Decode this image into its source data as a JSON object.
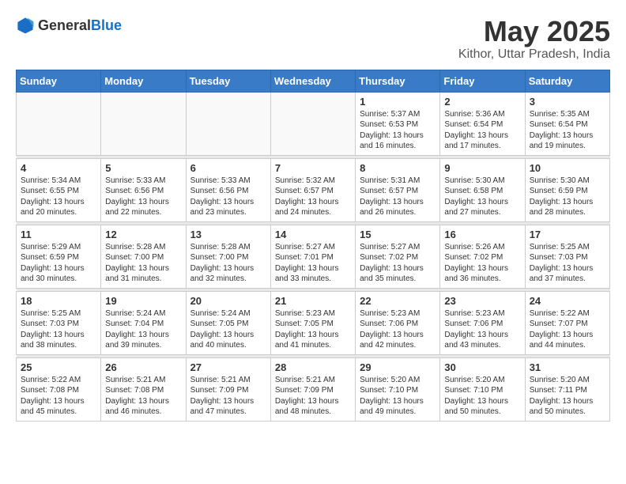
{
  "logo": {
    "general": "General",
    "blue": "Blue"
  },
  "header": {
    "month": "May 2025",
    "location": "Kithor, Uttar Pradesh, India"
  },
  "weekdays": [
    "Sunday",
    "Monday",
    "Tuesday",
    "Wednesday",
    "Thursday",
    "Friday",
    "Saturday"
  ],
  "weeks": [
    [
      {
        "day": "",
        "info": ""
      },
      {
        "day": "",
        "info": ""
      },
      {
        "day": "",
        "info": ""
      },
      {
        "day": "",
        "info": ""
      },
      {
        "day": "1",
        "info": "Sunrise: 5:37 AM\nSunset: 6:53 PM\nDaylight: 13 hours\nand 16 minutes."
      },
      {
        "day": "2",
        "info": "Sunrise: 5:36 AM\nSunset: 6:54 PM\nDaylight: 13 hours\nand 17 minutes."
      },
      {
        "day": "3",
        "info": "Sunrise: 5:35 AM\nSunset: 6:54 PM\nDaylight: 13 hours\nand 19 minutes."
      }
    ],
    [
      {
        "day": "4",
        "info": "Sunrise: 5:34 AM\nSunset: 6:55 PM\nDaylight: 13 hours\nand 20 minutes."
      },
      {
        "day": "5",
        "info": "Sunrise: 5:33 AM\nSunset: 6:56 PM\nDaylight: 13 hours\nand 22 minutes."
      },
      {
        "day": "6",
        "info": "Sunrise: 5:33 AM\nSunset: 6:56 PM\nDaylight: 13 hours\nand 23 minutes."
      },
      {
        "day": "7",
        "info": "Sunrise: 5:32 AM\nSunset: 6:57 PM\nDaylight: 13 hours\nand 24 minutes."
      },
      {
        "day": "8",
        "info": "Sunrise: 5:31 AM\nSunset: 6:57 PM\nDaylight: 13 hours\nand 26 minutes."
      },
      {
        "day": "9",
        "info": "Sunrise: 5:30 AM\nSunset: 6:58 PM\nDaylight: 13 hours\nand 27 minutes."
      },
      {
        "day": "10",
        "info": "Sunrise: 5:30 AM\nSunset: 6:59 PM\nDaylight: 13 hours\nand 28 minutes."
      }
    ],
    [
      {
        "day": "11",
        "info": "Sunrise: 5:29 AM\nSunset: 6:59 PM\nDaylight: 13 hours\nand 30 minutes."
      },
      {
        "day": "12",
        "info": "Sunrise: 5:28 AM\nSunset: 7:00 PM\nDaylight: 13 hours\nand 31 minutes."
      },
      {
        "day": "13",
        "info": "Sunrise: 5:28 AM\nSunset: 7:00 PM\nDaylight: 13 hours\nand 32 minutes."
      },
      {
        "day": "14",
        "info": "Sunrise: 5:27 AM\nSunset: 7:01 PM\nDaylight: 13 hours\nand 33 minutes."
      },
      {
        "day": "15",
        "info": "Sunrise: 5:27 AM\nSunset: 7:02 PM\nDaylight: 13 hours\nand 35 minutes."
      },
      {
        "day": "16",
        "info": "Sunrise: 5:26 AM\nSunset: 7:02 PM\nDaylight: 13 hours\nand 36 minutes."
      },
      {
        "day": "17",
        "info": "Sunrise: 5:25 AM\nSunset: 7:03 PM\nDaylight: 13 hours\nand 37 minutes."
      }
    ],
    [
      {
        "day": "18",
        "info": "Sunrise: 5:25 AM\nSunset: 7:03 PM\nDaylight: 13 hours\nand 38 minutes."
      },
      {
        "day": "19",
        "info": "Sunrise: 5:24 AM\nSunset: 7:04 PM\nDaylight: 13 hours\nand 39 minutes."
      },
      {
        "day": "20",
        "info": "Sunrise: 5:24 AM\nSunset: 7:05 PM\nDaylight: 13 hours\nand 40 minutes."
      },
      {
        "day": "21",
        "info": "Sunrise: 5:23 AM\nSunset: 7:05 PM\nDaylight: 13 hours\nand 41 minutes."
      },
      {
        "day": "22",
        "info": "Sunrise: 5:23 AM\nSunset: 7:06 PM\nDaylight: 13 hours\nand 42 minutes."
      },
      {
        "day": "23",
        "info": "Sunrise: 5:23 AM\nSunset: 7:06 PM\nDaylight: 13 hours\nand 43 minutes."
      },
      {
        "day": "24",
        "info": "Sunrise: 5:22 AM\nSunset: 7:07 PM\nDaylight: 13 hours\nand 44 minutes."
      }
    ],
    [
      {
        "day": "25",
        "info": "Sunrise: 5:22 AM\nSunset: 7:08 PM\nDaylight: 13 hours\nand 45 minutes."
      },
      {
        "day": "26",
        "info": "Sunrise: 5:21 AM\nSunset: 7:08 PM\nDaylight: 13 hours\nand 46 minutes."
      },
      {
        "day": "27",
        "info": "Sunrise: 5:21 AM\nSunset: 7:09 PM\nDaylight: 13 hours\nand 47 minutes."
      },
      {
        "day": "28",
        "info": "Sunrise: 5:21 AM\nSunset: 7:09 PM\nDaylight: 13 hours\nand 48 minutes."
      },
      {
        "day": "29",
        "info": "Sunrise: 5:20 AM\nSunset: 7:10 PM\nDaylight: 13 hours\nand 49 minutes."
      },
      {
        "day": "30",
        "info": "Sunrise: 5:20 AM\nSunset: 7:10 PM\nDaylight: 13 hours\nand 50 minutes."
      },
      {
        "day": "31",
        "info": "Sunrise: 5:20 AM\nSunset: 7:11 PM\nDaylight: 13 hours\nand 50 minutes."
      }
    ]
  ]
}
